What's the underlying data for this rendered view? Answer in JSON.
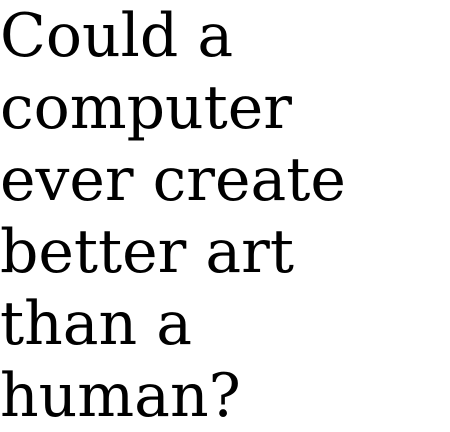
{
  "question": {
    "lines": [
      "Could a",
      "computer",
      "ever create",
      "better art",
      "than a",
      "human?"
    ]
  },
  "colors": {
    "background": "#ffffff",
    "text": "#000000"
  }
}
